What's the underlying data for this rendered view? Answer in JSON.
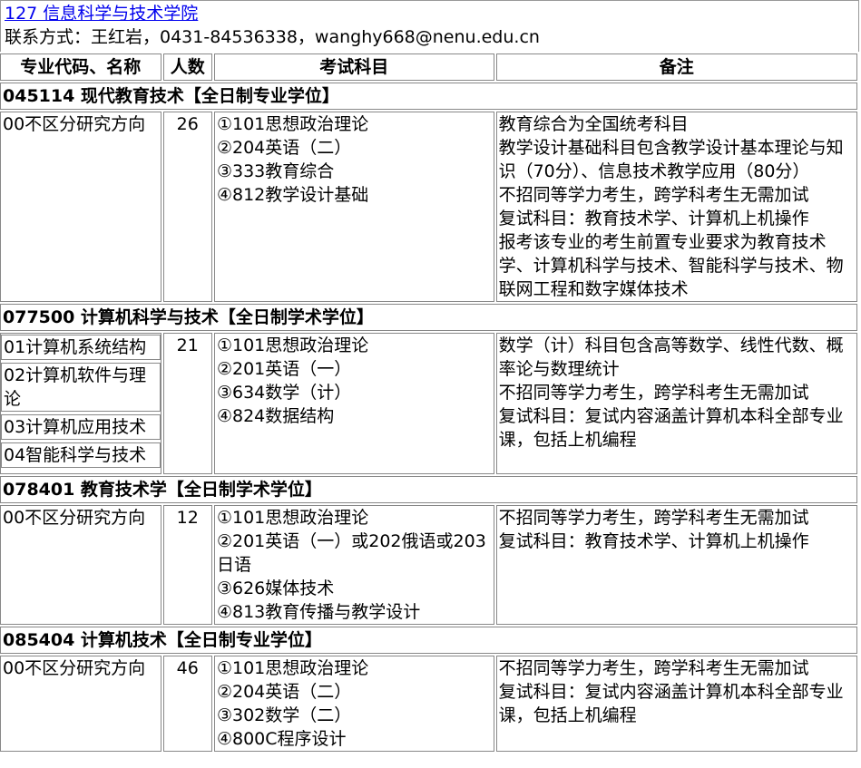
{
  "college": {
    "title": "127 信息科学与技术学院",
    "contact": "联系方式：王红岩，0431-84536338，wanghy668@nenu.edu.cn"
  },
  "headers": [
    "专业代码、名称",
    "人数",
    "考试科目",
    "备注"
  ],
  "programs": [
    {
      "section": "045114 现代教育技术【全日制专业学位】",
      "directions": [
        "00不区分研究方向"
      ],
      "count": "26",
      "subjects": [
        "①101思想政治理论",
        "②204英语（二）",
        "③333教育综合",
        "④812教学设计基础"
      ],
      "notes": [
        "教育综合为全国统考科目",
        "教学设计基础科目包含教学设计基本理论与知识（70分）、信息技术教学应用（80分）",
        "不招同等学力考生，跨学科考生无需加试",
        "复试科目：教育技术学、计算机上机操作",
        "报考该专业的考生前置专业要求为教育技术学、计算机科学与技术、智能科学与技术、物联网工程和数字媒体技术"
      ]
    },
    {
      "section": "077500 计算机科学与技术【全日制学术学位】",
      "directions": [
        "01计算机系统结构",
        "02计算机软件与理论",
        "03计算机应用技术",
        "04智能科学与技术"
      ],
      "count": "21",
      "subjects": [
        "①101思想政治理论",
        "②201英语（一）",
        "③634数学（计）",
        "④824数据结构"
      ],
      "notes": [
        "数学（计）科目包含高等数学、线性代数、概率论与数理统计",
        "不招同等学力考生，跨学科考生无需加试",
        "复试科目：复试内容涵盖计算机本科全部专业课，包括上机编程"
      ]
    },
    {
      "section": "078401 教育技术学【全日制学术学位】",
      "directions": [
        "00不区分研究方向"
      ],
      "count": "12",
      "subjects": [
        "①101思想政治理论",
        "②201英语（一）或202俄语或203日语",
        "③626媒体技术",
        "④813教育传播与教学设计"
      ],
      "notes": [
        "不招同等学力考生，跨学科考生无需加试",
        "复试科目：教育技术学、计算机上机操作"
      ]
    },
    {
      "section": "085404 计算机技术【全日制专业学位】",
      "directions": [
        "00不区分研究方向"
      ],
      "count": "46",
      "subjects": [
        "①101思想政治理论",
        "②204英语（二）",
        "③302数学（二）",
        "④800C程序设计"
      ],
      "notes": [
        "不招同等学力考生，跨学科考生无需加试",
        "复试科目：复试内容涵盖计算机本科全部专业课，包括上机编程"
      ]
    }
  ]
}
